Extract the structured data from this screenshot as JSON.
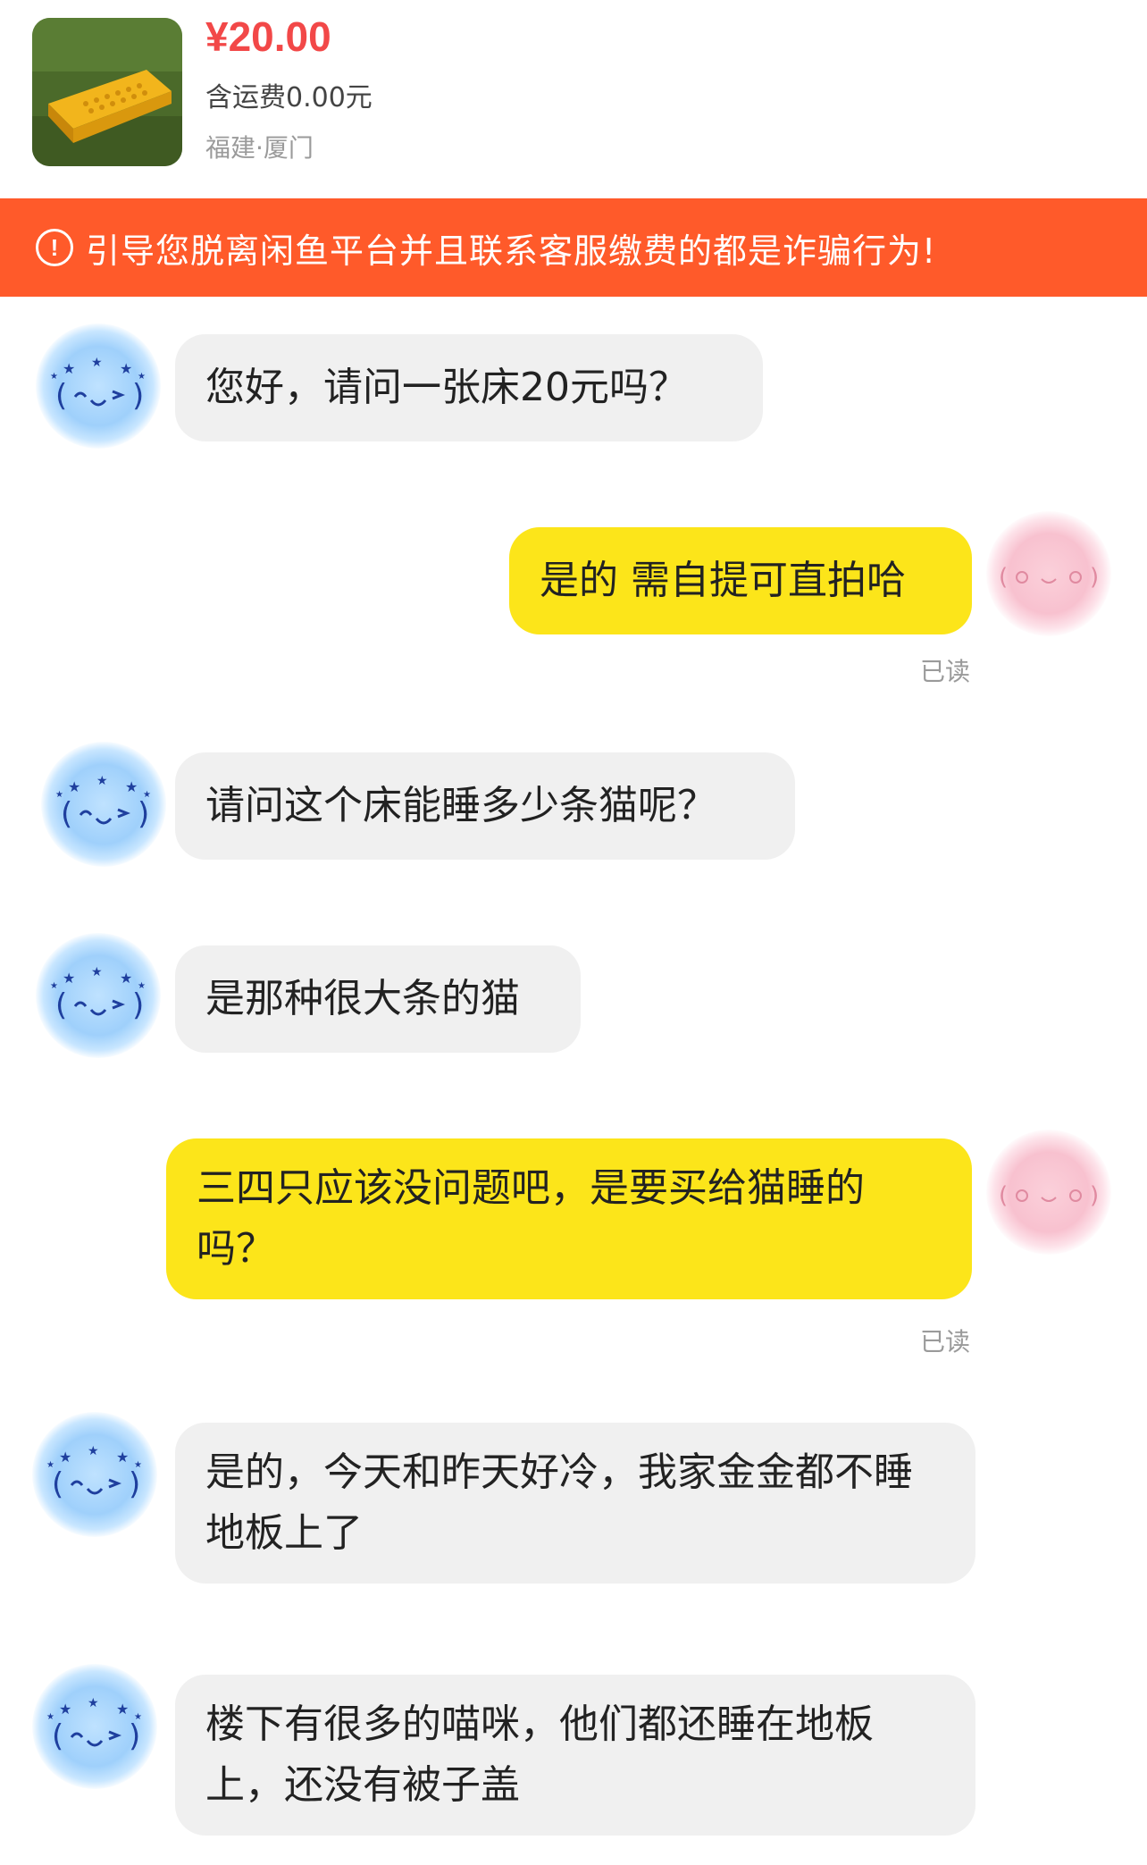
{
  "product": {
    "price": "¥20.00",
    "shipping": "含运费0.00元",
    "location": "福建·厦门",
    "thumbnail_icon": "cot-bed-photo-icon"
  },
  "warning": {
    "icon": "exclamation-circle-icon",
    "text": "引导您脱离闲鱼平台并且联系客服缴费的都是诈骗行为!"
  },
  "messages": [
    {
      "side": "in",
      "text": "您好，请问一张床20元吗？"
    },
    {
      "side": "out",
      "text": "是的 需自提可直拍哈",
      "status": "已读"
    },
    {
      "side": "in",
      "text": "请问这个床能睡多少条猫呢？"
    },
    {
      "side": "in",
      "text": "是那种很大条的猫"
    },
    {
      "side": "out",
      "text": "三四只应该没问题吧，是要买给猫睡的吗？",
      "status": "已读"
    },
    {
      "side": "in",
      "text": "是的，今天和昨天好冷，我家金金都不睡地板上了"
    },
    {
      "side": "in",
      "text": "楼下有很多的喵咪，他们都还睡在地板上，还没有被子盖"
    }
  ],
  "colors": {
    "price": "#f24848",
    "banner": "#ff5a2a",
    "out_bubble": "#fce51a",
    "in_bubble": "#f0f0f0"
  }
}
